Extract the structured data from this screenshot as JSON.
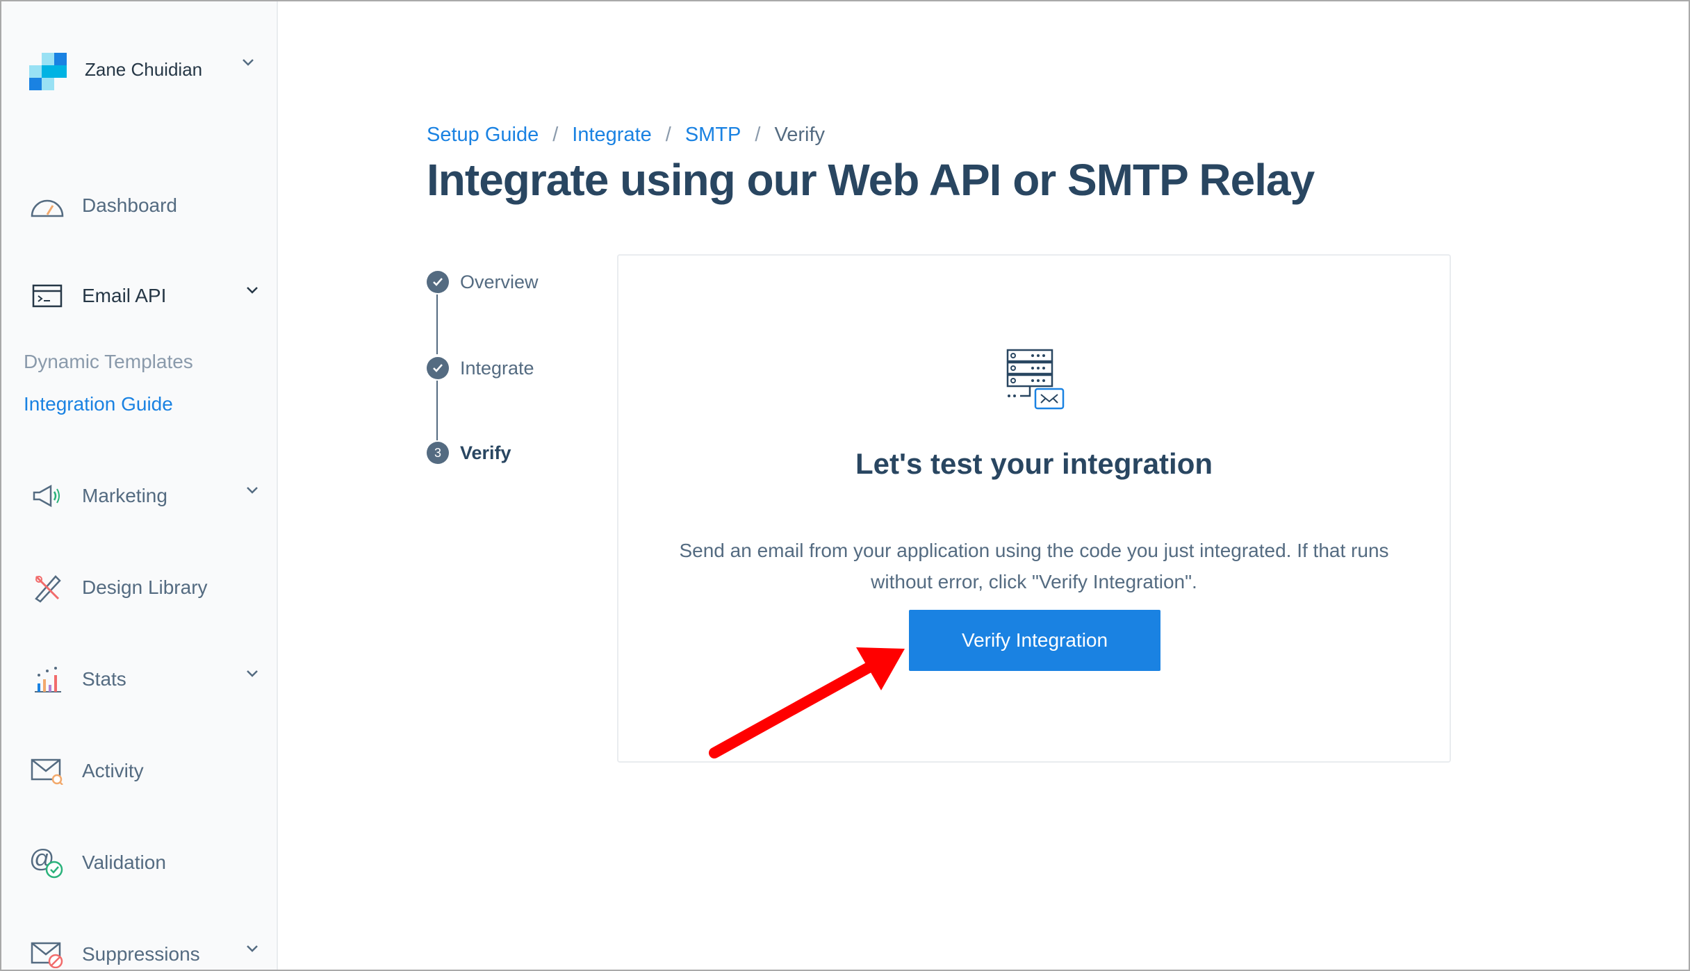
{
  "account": {
    "name": "Zane Chuidian",
    "brand_colors": [
      "#1a82e2",
      "#00b3e3",
      "#99e1f4"
    ]
  },
  "sidebar": {
    "items": [
      {
        "label": "Dashboard",
        "icon": "dashboard-gauge-icon"
      },
      {
        "label": "Email API",
        "icon": "email-api-terminal-icon",
        "expanded": true
      },
      {
        "label": "Marketing",
        "icon": "megaphone-icon"
      },
      {
        "label": "Design Library",
        "icon": "design-tools-icon"
      },
      {
        "label": "Stats",
        "icon": "stats-chart-icon"
      },
      {
        "label": "Activity",
        "icon": "activity-envelope-icon"
      },
      {
        "label": "Validation",
        "icon": "at-check-icon"
      },
      {
        "label": "Suppressions",
        "icon": "envelope-block-icon"
      }
    ],
    "email_api_sub": [
      {
        "label": "Dynamic Templates"
      },
      {
        "label": "Integration Guide"
      }
    ]
  },
  "breadcrumb": {
    "items": [
      "Setup Guide",
      "Integrate",
      "SMTP",
      "Verify"
    ],
    "separator": "/"
  },
  "page": {
    "title": "Integrate using our Web API or SMTP Relay"
  },
  "steps": [
    {
      "label": "Overview",
      "state": "done"
    },
    {
      "label": "Integrate",
      "state": "done"
    },
    {
      "label": "Verify",
      "state": "current",
      "number": "3"
    }
  ],
  "card": {
    "title": "Let's test your integration",
    "text": "Send an email from your application using the code you just integrated. If that runs without error, click \"Verify Integration\".",
    "button_label": "Verify Integration",
    "icon": "server-mail-icon"
  },
  "colors": {
    "accent": "#1a82e2",
    "heading": "#294661",
    "text": "#546b81",
    "annotation_arrow": "#ff0000"
  }
}
